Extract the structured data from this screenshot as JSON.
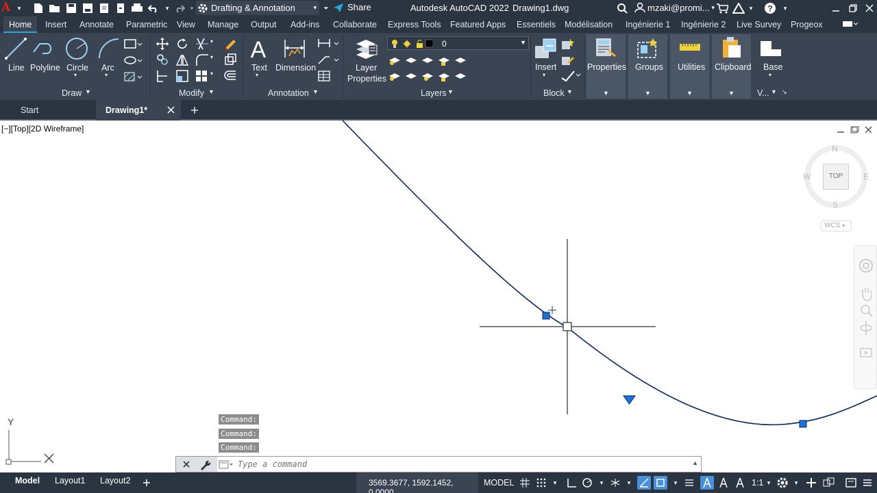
{
  "app": {
    "name": "Autodesk AutoCAD 2022",
    "document": "Drawing1.dwg",
    "workspace": "Drafting & Annotation",
    "share_label": "Share",
    "user": "mzaki@promi...",
    "logo": "A"
  },
  "ribbon_tabs": [
    "Home",
    "Insert",
    "Annotate",
    "Parametric",
    "View",
    "Manage",
    "Output",
    "Add-ins",
    "Collaborate",
    "Express Tools",
    "Featured Apps",
    "Essentiels",
    "Modélisation",
    "Ingénierie 1",
    "Ingénierie 2",
    "Live Survey",
    "Progeox"
  ],
  "ribbon": {
    "draw": {
      "panel": "Draw",
      "line": "Line",
      "polyline": "Polyline",
      "circle": "Circle",
      "arc": "Arc"
    },
    "modify": {
      "panel": "Modify"
    },
    "annotation": {
      "panel": "Annotation",
      "text": "Text",
      "dimension": "Dimension"
    },
    "layers": {
      "panel": "Layers",
      "layer_properties_1": "Layer",
      "layer_properties_2": "Properties",
      "current_layer": "0"
    },
    "block": {
      "panel": "Block",
      "insert": "Insert"
    },
    "properties": {
      "label": "Properties"
    },
    "groups": {
      "label": "Groups"
    },
    "utilities": {
      "label": "Utilities"
    },
    "clipboard": {
      "label": "Clipboard"
    },
    "base": {
      "label": "Base",
      "panel": "V..."
    }
  },
  "doc_tabs": {
    "start": "Start",
    "drawing": "Drawing1*"
  },
  "viewport": {
    "label": "[−][Top][2D Wireframe]",
    "viewcube": {
      "top": "TOP",
      "n": "N",
      "s": "S",
      "e": "E",
      "w": "W",
      "ucs": "WCS"
    },
    "ucs_x": "X",
    "ucs_y": "Y"
  },
  "command": {
    "history": [
      "Command:",
      "Command:",
      "Command:"
    ],
    "placeholder": "Type a command"
  },
  "statusbar": {
    "tabs": [
      "Model",
      "Layout1",
      "Layout2"
    ],
    "coordinates": "3569.3677, 1592.1452, 0.0000",
    "mode": "MODEL",
    "scale": "1:1"
  },
  "colors": {
    "titlebar": "#2b3441",
    "ribbon": "#3b4453",
    "accent": "#29a8e0",
    "grip": "#1e6fd9",
    "curve": "#0a2a66"
  }
}
